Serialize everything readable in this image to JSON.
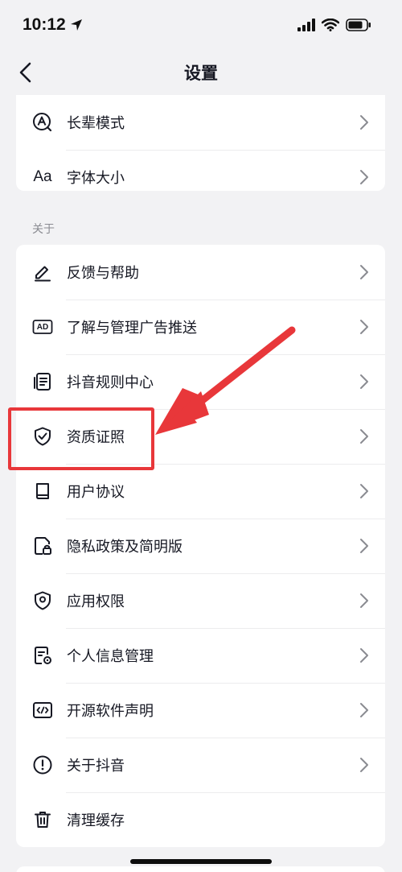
{
  "status_bar": {
    "time": "10:12"
  },
  "nav": {
    "title": "设置"
  },
  "top_card": {
    "items": [
      {
        "label": "长辈模式",
        "icon": "elder-mode-icon"
      },
      {
        "label": "字体大小",
        "icon": "font-size-icon",
        "icon_text": "Aa"
      }
    ]
  },
  "about": {
    "section_label": "关于",
    "items": [
      {
        "label": "反馈与帮助",
        "icon": "pencil-icon"
      },
      {
        "label": "了解与管理广告推送",
        "icon": "ad-icon",
        "icon_text": "AD"
      },
      {
        "label": "抖音规则中心",
        "icon": "rules-document-icon"
      },
      {
        "label": "资质证照",
        "icon": "shield-check-icon"
      },
      {
        "label": "用户协议",
        "icon": "book-icon"
      },
      {
        "label": "隐私政策及简明版",
        "icon": "privacy-lock-icon"
      },
      {
        "label": "应用权限",
        "icon": "location-shield-icon"
      },
      {
        "label": "个人信息管理",
        "icon": "personal-info-icon"
      },
      {
        "label": "开源软件声明",
        "icon": "code-icon"
      },
      {
        "label": "关于抖音",
        "icon": "info-icon"
      },
      {
        "label": "清理缓存",
        "icon": "trash-icon"
      }
    ]
  },
  "colors": {
    "background": "#f2f2f4",
    "card": "#ffffff",
    "text": "#161823",
    "secondary_text": "#8a8b91",
    "annotation_red": "#e8373a"
  }
}
